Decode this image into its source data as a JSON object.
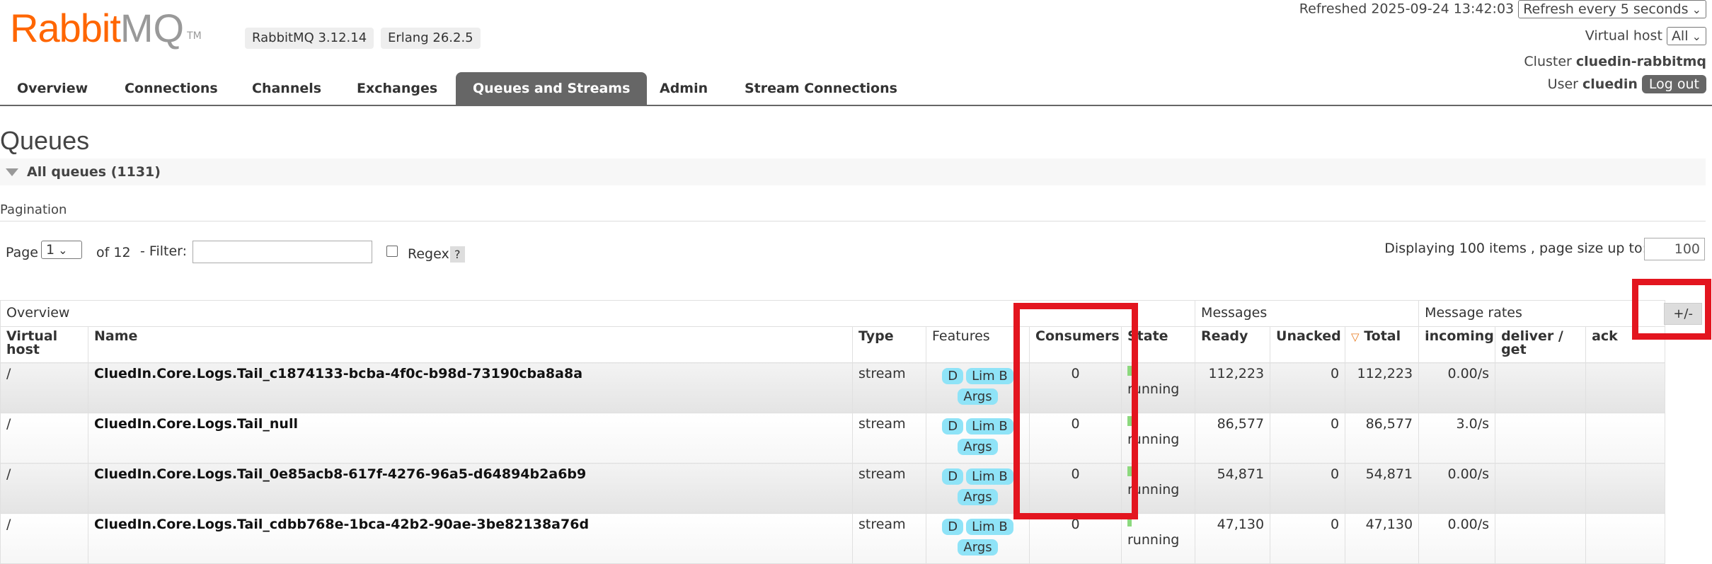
{
  "header": {
    "logo_rabbit": "Rabbit",
    "logo_mq": "MQ",
    "logo_tm": "TM",
    "version": "RabbitMQ 3.12.14",
    "erlang": "Erlang 26.2.5",
    "refreshed": "Refreshed 2025-09-24 13:42:03",
    "refresh_option": "Refresh every 5 seconds",
    "vhost_label": "Virtual host",
    "vhost_value": "All",
    "cluster_label": "Cluster",
    "cluster_value": "cluedin-rabbitmq",
    "user_label": "User",
    "user_value": "cluedin",
    "logout": "Log out"
  },
  "nav": {
    "tabs": [
      "Overview",
      "Connections",
      "Channels",
      "Exchanges",
      "Queues and Streams",
      "Admin",
      "Stream Connections"
    ],
    "active": "Queues and Streams"
  },
  "page": {
    "title": "Queues",
    "section": "All queues (1131)",
    "pagination_label": "Pagination",
    "page_label": "Page",
    "page_value": "1",
    "of_label": "of 12",
    "filter_label": "- Filter:",
    "filter_value": "",
    "regex_label": "Regex",
    "help": "?",
    "displaying": "Displaying 100 items , page size up to:",
    "page_size": "100",
    "plus_minus": "+/-"
  },
  "table": {
    "groups": {
      "overview": "Overview",
      "messages": "Messages",
      "rates": "Message rates"
    },
    "columns": {
      "vhost": "Virtual host",
      "name": "Name",
      "type": "Type",
      "features": "Features",
      "consumers": "Consumers",
      "state": "State",
      "ready": "Ready",
      "unacked": "Unacked",
      "total": "Total",
      "incoming": "incoming",
      "deliver": "deliver / get",
      "ack": "ack"
    },
    "sort_icon": "▽",
    "feature_tags": [
      "D",
      "Lim B",
      "Args"
    ],
    "rows": [
      {
        "vhost": "/",
        "name": "CluedIn.Core.Logs.Tail_c1874133-bcba-4f0c-b98d-73190cba8a8a",
        "type": "stream",
        "consumers": "0",
        "state": "running",
        "ready": "112,223",
        "unacked": "0",
        "total": "112,223",
        "incoming": "0.00/s",
        "deliver": "",
        "ack": ""
      },
      {
        "vhost": "/",
        "name": "CluedIn.Core.Logs.Tail_null",
        "type": "stream",
        "consumers": "0",
        "state": "running",
        "ready": "86,577",
        "unacked": "0",
        "total": "86,577",
        "incoming": "3.0/s",
        "deliver": "",
        "ack": ""
      },
      {
        "vhost": "/",
        "name": "CluedIn.Core.Logs.Tail_0e85acb8-617f-4276-96a5-d64894b2a6b9",
        "type": "stream",
        "consumers": "0",
        "state": "running",
        "ready": "54,871",
        "unacked": "0",
        "total": "54,871",
        "incoming": "0.00/s",
        "deliver": "",
        "ack": ""
      },
      {
        "vhost": "/",
        "name": "CluedIn.Core.Logs.Tail_cdbb768e-1bca-42b2-90ae-3be82138a76d",
        "type": "stream",
        "consumers": "0",
        "state": "running",
        "ready": "47,130",
        "unacked": "0",
        "total": "47,130",
        "incoming": "0.00/s",
        "deliver": "",
        "ack": ""
      }
    ]
  },
  "colors": {
    "brand": "#ff6600",
    "annotation": "#e3151f",
    "tag": "#8fe3f7",
    "nav_active": "#666666"
  }
}
